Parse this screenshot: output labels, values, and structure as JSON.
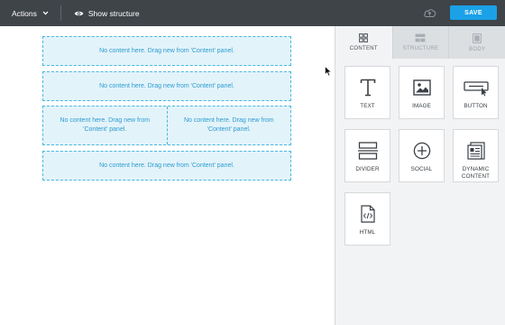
{
  "topbar": {
    "actions_label": "Actions",
    "show_structure_label": "Show structure",
    "save_label": "SAVE",
    "colors": {
      "background": "#3f4449",
      "save": "#1aa1e8"
    }
  },
  "canvas": {
    "rows": [
      {
        "cells": [
          "No content here. Drag new from 'Content' panel."
        ]
      },
      {
        "cells": [
          "No content here. Drag new from 'Content' panel."
        ]
      },
      {
        "cells": [
          "No content here. Drag new from 'Content' panel.",
          "No content here. Drag new from 'Content' panel."
        ]
      },
      {
        "cells": [
          "No content here. Drag new from 'Content' panel."
        ]
      }
    ],
    "colors": {
      "placeholder_bg": "#e3f3fa",
      "placeholder_border": "#49b8dd",
      "placeholder_text": "#2b9cd0"
    }
  },
  "panel": {
    "tabs": [
      {
        "label": "CONTENT",
        "icon": "grid-icon",
        "active": true
      },
      {
        "label": "STRUCTURE",
        "icon": "structure-icon",
        "active": false
      },
      {
        "label": "BODY",
        "icon": "body-icon",
        "active": false
      }
    ],
    "blocks": [
      {
        "label": "TEXT",
        "icon": "text-icon"
      },
      {
        "label": "IMAGE",
        "icon": "image-icon"
      },
      {
        "label": "BUTTON",
        "icon": "button-icon"
      },
      {
        "label": "DIVIDER",
        "icon": "divider-icon"
      },
      {
        "label": "SOCIAL",
        "icon": "social-icon"
      },
      {
        "label": "DYNAMIC CONTENT",
        "label_line1": "DYNAMIC",
        "label_line2": "CONTENT",
        "icon": "dynamic-content-icon"
      },
      {
        "label": "HTML",
        "icon": "html-icon"
      }
    ]
  }
}
